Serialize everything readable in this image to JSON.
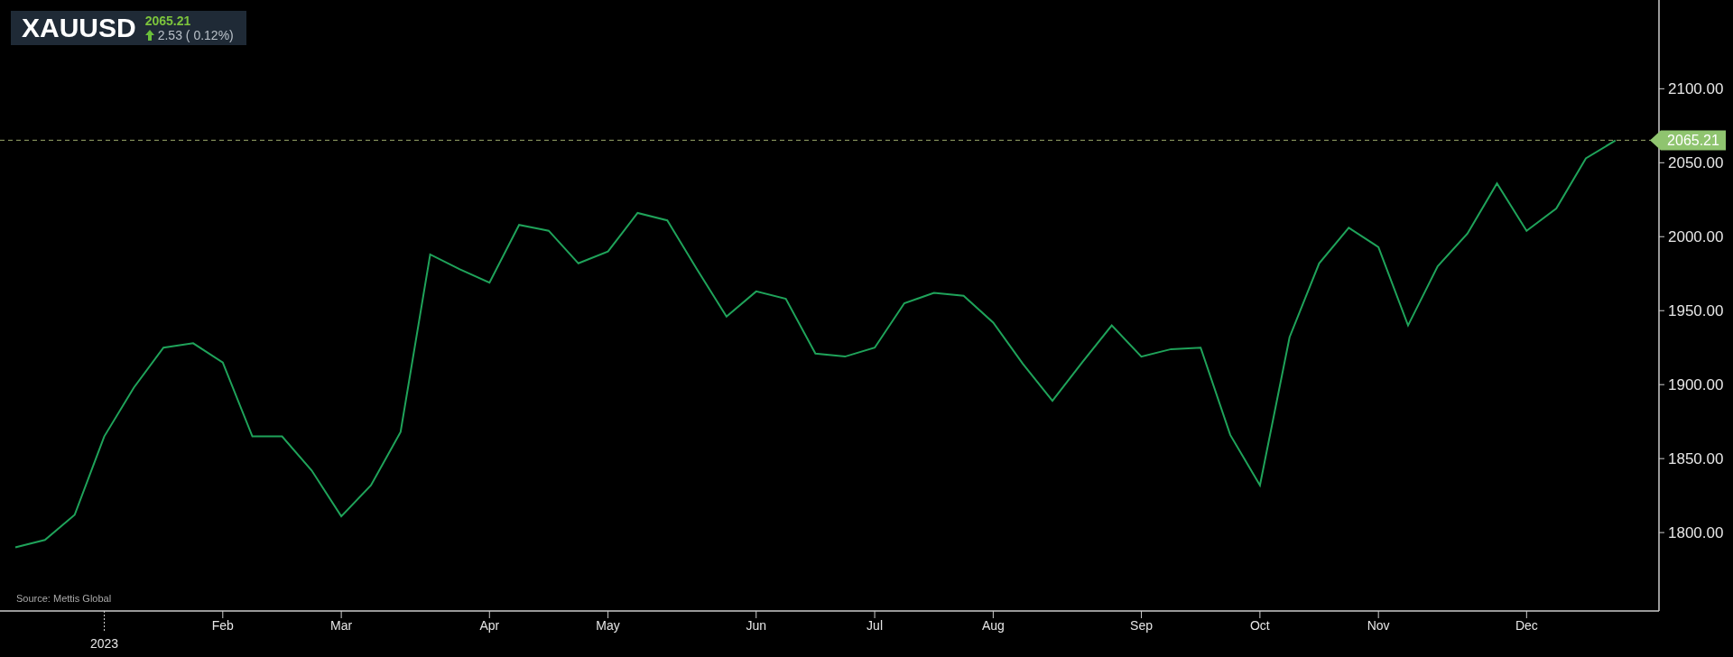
{
  "header": {
    "symbol": "XAUUSD",
    "price": "2065.21",
    "change": "2.53 ( 0.12%)",
    "rising": true
  },
  "chart": {
    "year_label": "2023",
    "source": "Source: Mettis Global",
    "chart_data": {
      "type": "line",
      "categories": [
        null,
        null,
        null,
        null,
        null,
        null,
        null,
        "Feb",
        null,
        null,
        null,
        "Mar",
        null,
        null,
        null,
        null,
        "Apr",
        null,
        null,
        null,
        "May",
        null,
        null,
        null,
        null,
        "Jun",
        null,
        null,
        null,
        "Jul",
        null,
        null,
        null,
        "Aug",
        null,
        null,
        null,
        null,
        "Sep",
        null,
        null,
        null,
        "Oct",
        null,
        null,
        null,
        "Nov",
        null,
        null,
        null,
        null,
        "Dec",
        null,
        null,
        null
      ],
      "series": [
        {
          "color": "#1fa35a",
          "values": [
            1790,
            1795,
            1812,
            1865,
            1898,
            1925,
            1928,
            1915,
            1865,
            1865,
            1842,
            1811,
            1832,
            1868,
            1988,
            1978,
            1969,
            2008,
            2004,
            1982,
            1990,
            2016,
            2011,
            1978,
            1946,
            1963,
            1958,
            1921,
            1919,
            1925,
            1955,
            1962,
            1960,
            1942,
            1914,
            1889,
            1915,
            1940,
            1919,
            1924,
            1925,
            1866,
            1832,
            1932,
            1982,
            2006,
            1993,
            1940,
            1980,
            2002,
            2036,
            2004,
            2019,
            2053,
            2065
          ]
        }
      ],
      "yticks": [
        {
          "value": 1800,
          "label": "1800.00"
        },
        {
          "value": 1850,
          "label": "1850.00"
        },
        {
          "value": 1900,
          "label": "1900.00"
        },
        {
          "value": 1950,
          "label": "1950.00"
        },
        {
          "value": 2000,
          "label": "2000.00"
        },
        {
          "value": 2050,
          "label": "2050.00"
        },
        {
          "value": 2100,
          "label": "2100.00"
        }
      ],
      "ylim": [
        1747,
        2160
      ],
      "ref_lines": [
        {
          "axis": "y",
          "value": 2065.21,
          "label": "2065.21"
        }
      ]
    }
  }
}
